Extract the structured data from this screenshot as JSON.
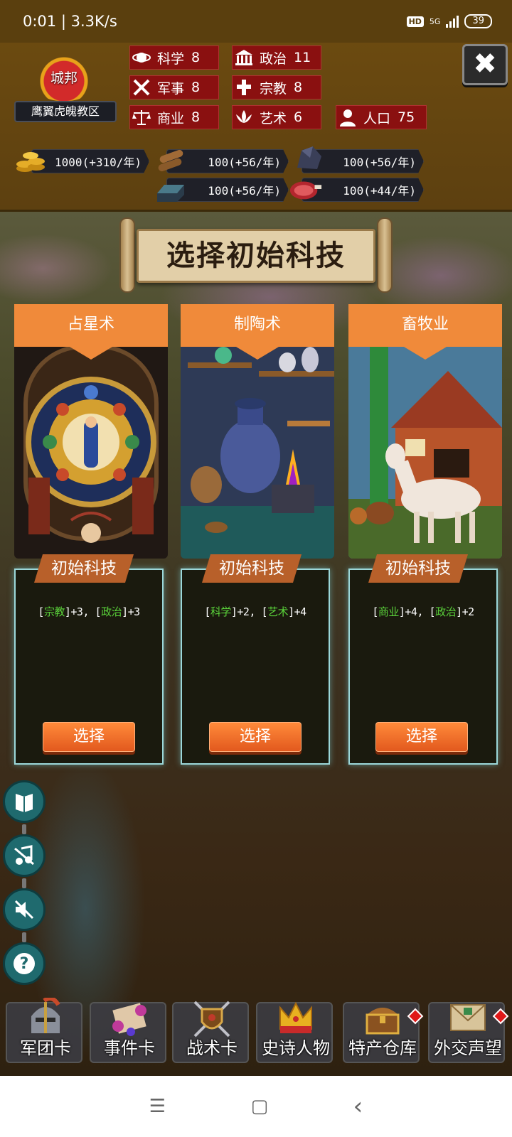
{
  "status_bar": {
    "time_speed": "0:01 | 3.3K/s",
    "hd": "HD",
    "network": "5G",
    "battery": "39"
  },
  "city": {
    "type_label": "城邦",
    "name": "鹰翼虎魄教区"
  },
  "stats": [
    {
      "label": "科学",
      "value": "8",
      "icon": "planet-icon"
    },
    {
      "label": "政治",
      "value": "11",
      "icon": "capitol-icon"
    },
    {
      "label": "军事",
      "value": "8",
      "icon": "crossed-swords-icon"
    },
    {
      "label": "宗教",
      "value": "8",
      "icon": "cross-icon"
    },
    {
      "label": "商业",
      "value": "8",
      "icon": "scales-icon"
    },
    {
      "label": "艺术",
      "value": "6",
      "icon": "lotus-icon"
    },
    {
      "label": "人口",
      "value": "75",
      "icon": "person-icon"
    }
  ],
  "resources": [
    {
      "value": "1000(+310/年)",
      "icon": "gold-coins-icon"
    },
    {
      "value": "100(+56/年)",
      "icon": "wood-logs-icon"
    },
    {
      "value": "100(+56/年)",
      "icon": "stone-ore-icon"
    },
    {
      "value": "100(+56/年)",
      "icon": "iron-ingot-icon"
    },
    {
      "value": "100(+44/年)",
      "icon": "meat-icon"
    }
  ],
  "title": "选择初始科技",
  "card_tag": "初始科技",
  "select_label": "选择",
  "cards": [
    {
      "name": "占星术",
      "art": "stained-glass-astrology",
      "bonus": [
        {
          "attr": "宗教",
          "amt": "+3"
        },
        {
          "attr": "政治",
          "amt": "+3"
        }
      ]
    },
    {
      "name": "制陶术",
      "art": "pottery-workshop",
      "bonus": [
        {
          "attr": "科学",
          "amt": "+2"
        },
        {
          "attr": "艺术",
          "amt": "+4"
        }
      ]
    },
    {
      "name": "畜牧业",
      "art": "barn-and-horse",
      "bonus": [
        {
          "attr": "商业",
          "amt": "+4"
        },
        {
          "attr": "政治",
          "amt": "+2"
        }
      ]
    }
  ],
  "side_buttons": [
    "book-icon",
    "no-music-icon",
    "sound-muted-icon",
    "help-icon"
  ],
  "dock": [
    {
      "label": "军团卡",
      "icon": "helmet-icon",
      "badge": false
    },
    {
      "label": "事件卡",
      "icon": "scroll-icon",
      "badge": false
    },
    {
      "label": "战术卡",
      "icon": "shield-swords-icon",
      "badge": false
    },
    {
      "label": "史诗人物",
      "icon": "crown-icon",
      "badge": false
    },
    {
      "label": "特产仓库",
      "icon": "treasure-chest-icon",
      "badge": true
    },
    {
      "label": "外交声望",
      "icon": "letter-icon",
      "badge": true
    }
  ],
  "navbar": {
    "menu": "☰",
    "home": "▢",
    "back": "‹"
  },
  "colors": {
    "header_bg": "#5d4010",
    "stat_red": "#8a1010",
    "card_orange": "#f08a3a",
    "highlight_green": "#5ad23a",
    "teal_button": "#1f6a6e"
  }
}
